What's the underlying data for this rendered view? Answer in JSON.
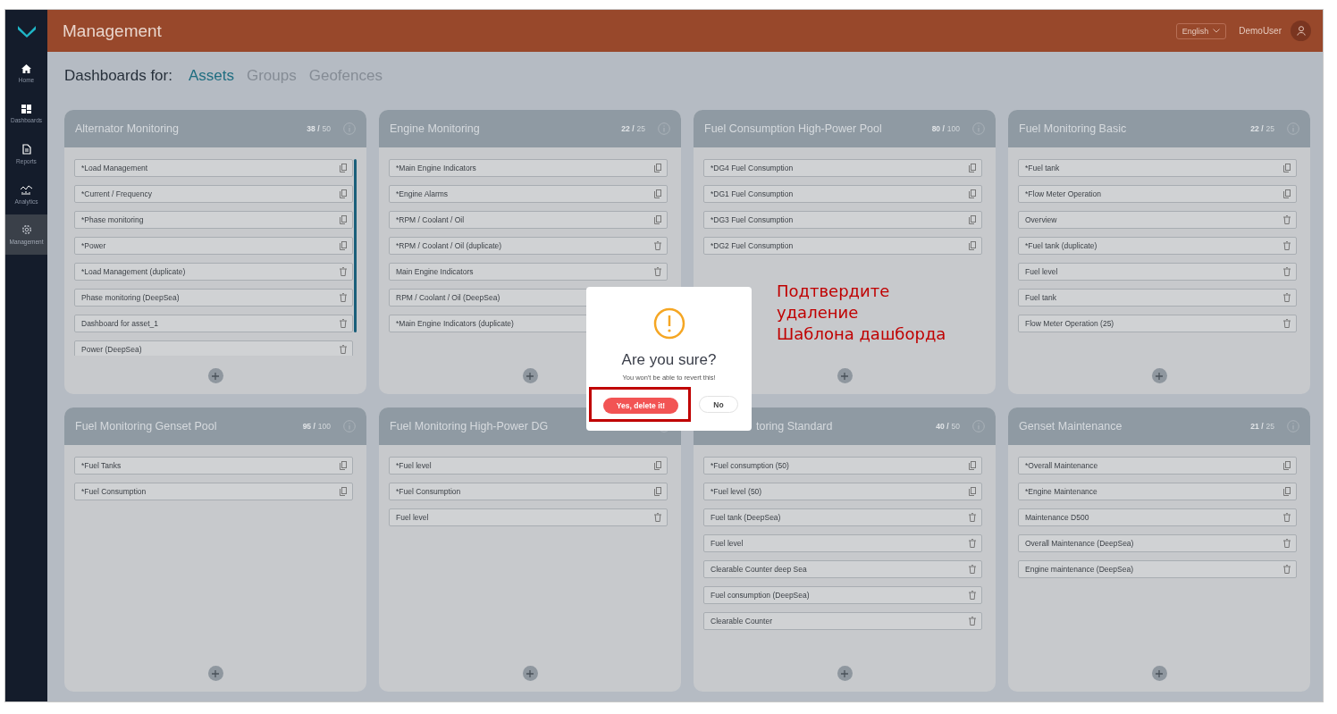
{
  "sidebar": {
    "items": [
      {
        "label": "Home",
        "selected": false
      },
      {
        "label": "Dashboards",
        "selected": false
      },
      {
        "label": "Reports",
        "selected": false
      },
      {
        "label": "Analytics",
        "selected": false
      },
      {
        "label": "Management",
        "selected": true
      }
    ]
  },
  "header": {
    "title": "Management",
    "language": "English",
    "user": "DemoUser"
  },
  "dashboards_for": {
    "label": "Dashboards for:",
    "tabs": [
      {
        "label": "Assets",
        "selected": true
      },
      {
        "label": "Groups",
        "selected": false
      },
      {
        "label": "Geofences",
        "selected": false
      }
    ]
  },
  "cards": [
    {
      "title": "Alternator Monitoring",
      "count": "38 /",
      "limit": "50",
      "scrollable": true,
      "items": [
        {
          "label": "*Load Management",
          "kind": "copy"
        },
        {
          "label": "*Current / Frequency",
          "kind": "copy"
        },
        {
          "label": "*Phase monitoring",
          "kind": "copy"
        },
        {
          "label": "*Power",
          "kind": "copy"
        },
        {
          "label": "*Load Management (duplicate)",
          "kind": "delete"
        },
        {
          "label": "Phase monitoring (DeepSea)",
          "kind": "delete"
        },
        {
          "label": "Dashboard for asset_1",
          "kind": "delete"
        },
        {
          "label": "Power (DeepSea)",
          "kind": "delete"
        }
      ]
    },
    {
      "title": "Engine Monitoring",
      "count": "22 /",
      "limit": "25",
      "items": [
        {
          "label": "*Main Engine Indicators",
          "kind": "copy"
        },
        {
          "label": "*Engine Alarms",
          "kind": "copy"
        },
        {
          "label": "*RPM / Coolant / Oil",
          "kind": "copy"
        },
        {
          "label": "*RPM / Coolant / Oil (duplicate)",
          "kind": "delete"
        },
        {
          "label": "Main Engine Indicators",
          "kind": "delete"
        },
        {
          "label": "RPM / Coolant / Oil (DeepSea)"
        },
        {
          "label": "*Main Engine Indicators (duplicate)"
        }
      ]
    },
    {
      "title": "Fuel Consumption High-Power Pool",
      "count": "80 /",
      "limit": "100",
      "items": [
        {
          "label": "*DG4 Fuel Consumption",
          "kind": "copy"
        },
        {
          "label": "*DG1 Fuel Consumption",
          "kind": "copy"
        },
        {
          "label": "*DG3 Fuel Consumption",
          "kind": "copy"
        },
        {
          "label": "*DG2 Fuel Consumption",
          "kind": "copy"
        }
      ]
    },
    {
      "title": "Fuel Monitoring Basic",
      "count": "22 /",
      "limit": "25",
      "items": [
        {
          "label": "*Fuel tank",
          "kind": "copy"
        },
        {
          "label": "*Flow Meter Operation",
          "kind": "copy"
        },
        {
          "label": "Overview",
          "kind": "delete"
        },
        {
          "label": "*Fuel tank (duplicate)",
          "kind": "delete"
        },
        {
          "label": "Fuel level",
          "kind": "delete"
        },
        {
          "label": "Fuel tank",
          "kind": "delete"
        },
        {
          "label": "Flow Meter Operation (25)",
          "kind": "delete"
        }
      ]
    },
    {
      "title": "Fuel Monitoring Genset Pool",
      "count": "95 /",
      "limit": "100",
      "items": [
        {
          "label": "*Fuel Tanks",
          "kind": "copy"
        },
        {
          "label": "*Fuel Consumption",
          "kind": "copy"
        }
      ]
    },
    {
      "title": "Fuel Monitoring High-Power DG",
      "items": [
        {
          "label": "*Fuel level",
          "kind": "copy"
        },
        {
          "label": "*Fuel Consumption",
          "kind": "copy"
        },
        {
          "label": "Fuel level",
          "kind": "delete"
        }
      ]
    },
    {
      "title": "toring Standard",
      "covered": true,
      "count": "40 /",
      "limit": "50",
      "items": [
        {
          "label": "*Fuel consumption (50)",
          "kind": "copy"
        },
        {
          "label": "*Fuel level (50)",
          "kind": "copy"
        },
        {
          "label": "Fuel tank (DeepSea)",
          "kind": "delete"
        },
        {
          "label": "Fuel level",
          "kind": "delete"
        },
        {
          "label": "Clearable Counter deep Sea",
          "kind": "delete"
        },
        {
          "label": "Fuel consumption (DeepSea)",
          "kind": "delete"
        },
        {
          "label": "Clearable Counter",
          "kind": "delete"
        }
      ]
    },
    {
      "title": "Genset Maintenance",
      "count": "21 /",
      "limit": "25",
      "items": [
        {
          "label": "*Overall Maintenance",
          "kind": "copy"
        },
        {
          "label": "*Engine Maintenance",
          "kind": "copy"
        },
        {
          "label": "Maintenance D500",
          "kind": "delete"
        },
        {
          "label": "Overall Maintenance (DeepSea)",
          "kind": "delete"
        },
        {
          "label": "Engine maintenance (DeepSea)",
          "kind": "delete"
        }
      ]
    }
  ],
  "dialog": {
    "title": "Are you sure?",
    "message": "You won't be able to revert this!",
    "confirm": "Yes, delete it!",
    "cancel": "No",
    "confirm_highlighted": true
  },
  "annotation": {
    "lines": [
      "Подтвердите",
      "удаление",
      "Шаблона дашборда"
    ]
  }
}
